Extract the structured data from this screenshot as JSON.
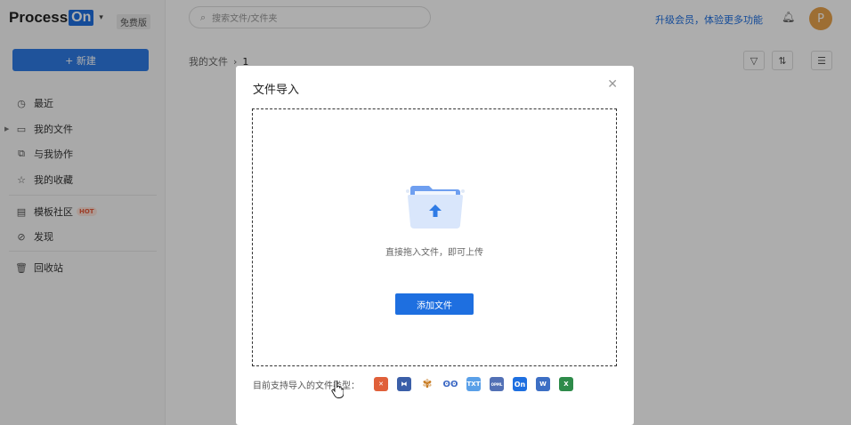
{
  "sidebar": {
    "logo": {
      "text": "Process",
      "badge": "On"
    },
    "edition": "免费版",
    "new_button": "+ 新建",
    "items": [
      {
        "label": "最近",
        "icon": "clock-icon"
      },
      {
        "label": "我的文件",
        "icon": "folder-icon"
      },
      {
        "label": "与我协作",
        "icon": "collaborate-icon"
      },
      {
        "label": "我的收藏",
        "icon": "star-icon"
      },
      {
        "label": "模板社区",
        "icon": "template-icon",
        "badge": "HOT"
      },
      {
        "label": "发现",
        "icon": "compass-icon"
      },
      {
        "label": "回收站",
        "icon": "trash-icon"
      }
    ]
  },
  "header": {
    "search_placeholder": "搜索文件/文件夹",
    "upgrade": "升级会员，体验更多功能",
    "avatar": "P"
  },
  "breadcrumb": {
    "root": "我的文件",
    "current": "1"
  },
  "modal": {
    "title": "文件导入",
    "drop_text": "直接拖入文件，即可上传",
    "add_button": "添加文件",
    "types_label": "目前支持导入的文件类型：",
    "file_types": [
      {
        "name": "xmind-icon",
        "color": "#e0603a"
      },
      {
        "name": "mindmanager-icon",
        "color": "#3b5fa8"
      },
      {
        "name": "butterfly-icon",
        "color": "#c77a1f"
      },
      {
        "name": "owl-icon",
        "color": "#3b68c4"
      },
      {
        "name": "txt-icon",
        "color": "#5aa0e8",
        "text": "TXT"
      },
      {
        "name": "opml-icon",
        "color": "#5270b5",
        "text": "OPML"
      },
      {
        "name": "processon-icon",
        "color": "#1e6fe0",
        "text": "On"
      },
      {
        "name": "word-icon",
        "color": "#3d6fc4",
        "text": "W"
      },
      {
        "name": "excel-icon",
        "color": "#2e8b4a",
        "text": "X"
      }
    ]
  }
}
